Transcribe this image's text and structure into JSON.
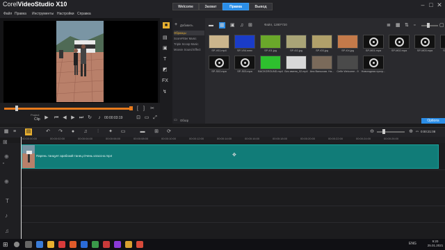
{
  "app": {
    "name_prefix": "Corel",
    "name_main": "VideoStudio X10"
  },
  "menu": [
    "Файл",
    "Правка",
    "Инструменты",
    "Настройки",
    "Справка"
  ],
  "steps": [
    {
      "label": "Welcome",
      "active": false
    },
    {
      "label": "Захват",
      "active": false
    },
    {
      "label": "Правка",
      "active": true
    },
    {
      "label": "Вывод",
      "active": false
    }
  ],
  "player": {
    "mode_project": "Project",
    "mode_clip": "Clip",
    "timecode": "00:00:03:19"
  },
  "library": {
    "add_label": "Добавить",
    "resolution": "Файл, 1280*720",
    "nav": [
      "Образцы",
      "ScoreFitter Music",
      "Triple Scoop Music",
      "Moovie Sound Effect"
    ],
    "browse_label": "Обзор",
    "options_label": "Options",
    "row1": [
      "SP-V01.mp4",
      "SP-V04.wmv",
      "SP-I01.jpg",
      "SP-I02.jpg",
      "SP-I03.jpg",
      "SP-I04.jpg",
      "SP-M01.mpa",
      "SP-M02.mpa",
      "SP-M03.mpa",
      "SP-S01.mpa"
    ],
    "row2": [
      "SP-S02.mpa",
      "SP-S03.mpa",
      "BACKGROUND.mp4",
      "Без имени_02.mp4",
      "Аня Вальская. На...",
      "Себе Welcome - 9",
      "Новогодняя прогр..."
    ]
  },
  "timeline": {
    "ruler": [
      "00:00:00:00",
      "00:00:02:00",
      "00:00:04:00",
      "00:00:06:00",
      "00:00:08:00",
      "00:00:10:00",
      "00:00:12:00",
      "00:00:14:00",
      "00:00:16:00",
      "00:00:18:00",
      "00:00:20:00",
      "00:00:22:00",
      "00:00:24:00",
      "00:00:26:00"
    ],
    "total": "0:00:21:08",
    "clip_name": "Парень танцует арабский танец.Очень классно.mp4"
  },
  "taskbar": {
    "time": "9:20",
    "date": "25.01.2021",
    "lang": "ENG"
  },
  "colors": {
    "accent": "#2b8ee8",
    "clip": "#117c78",
    "scrubber": "#e87a1c"
  }
}
